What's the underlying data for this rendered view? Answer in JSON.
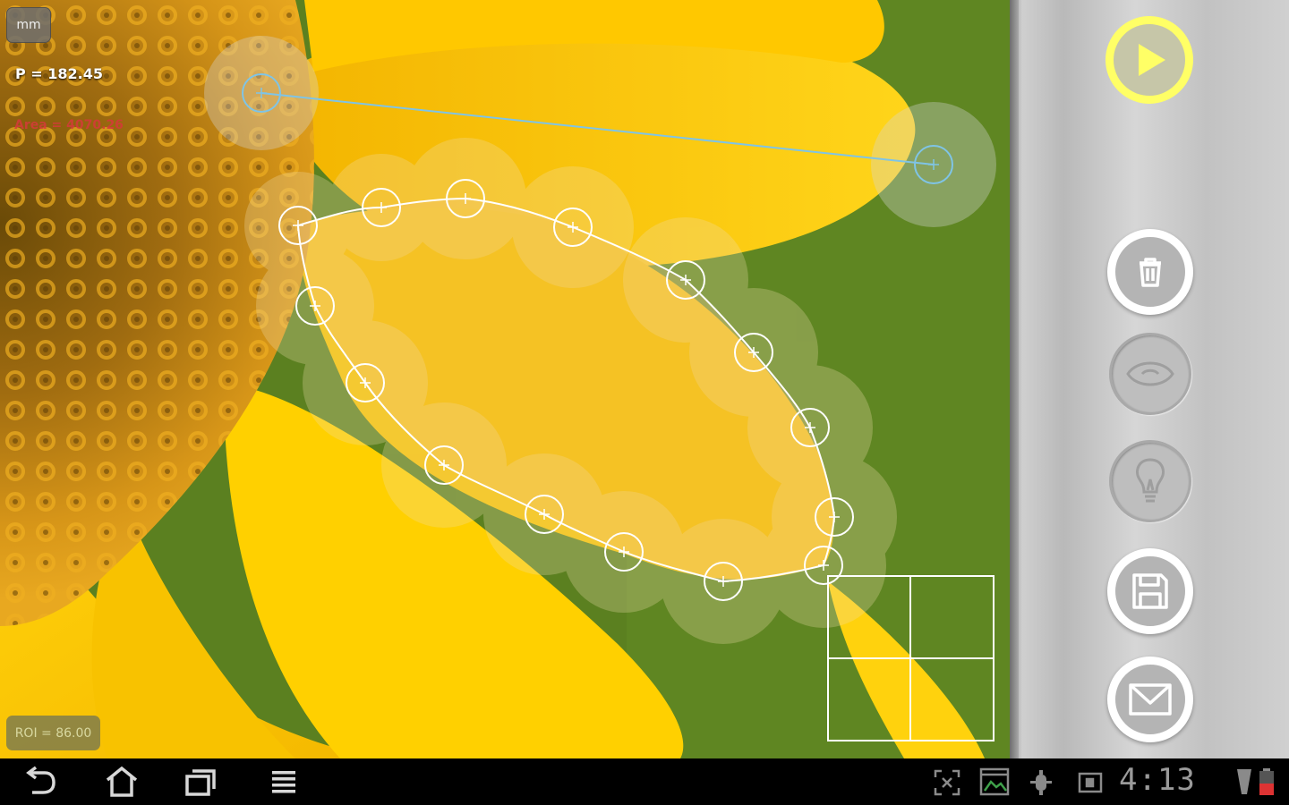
{
  "canvas": {
    "unit_label": "mm",
    "perimeter": "P = 182.45",
    "area": "Area = 4070.26",
    "roi": "ROI = 86.00"
  },
  "sidebar": {
    "buttons": [
      {
        "name": "play-button",
        "icon": "play-icon",
        "state": "active"
      },
      {
        "name": "delete-button",
        "icon": "trash-icon",
        "state": "enabled"
      },
      {
        "name": "eye-button",
        "icon": "eye-icon",
        "state": "disabled"
      },
      {
        "name": "bulb-button",
        "icon": "lightbulb-icon",
        "state": "disabled"
      },
      {
        "name": "save-button",
        "icon": "floppy-disk-icon",
        "state": "enabled"
      },
      {
        "name": "email-button",
        "icon": "envelope-icon",
        "state": "enabled"
      }
    ]
  },
  "system_bar": {
    "clock": "4:13",
    "left_icons": [
      "back-icon",
      "home-icon",
      "recent-apps-icon",
      "menu-icon"
    ],
    "status_icons": [
      "screenshot-icon",
      "gallery-icon",
      "usb-debug-icon",
      "sd-card-icon",
      "signal-icon",
      "battery-icon"
    ]
  },
  "colors": {
    "play_accent": "#ffff66",
    "measure_line": "#7fc4e6",
    "area_text": "#d63a3a",
    "outline": "#ffffff"
  }
}
